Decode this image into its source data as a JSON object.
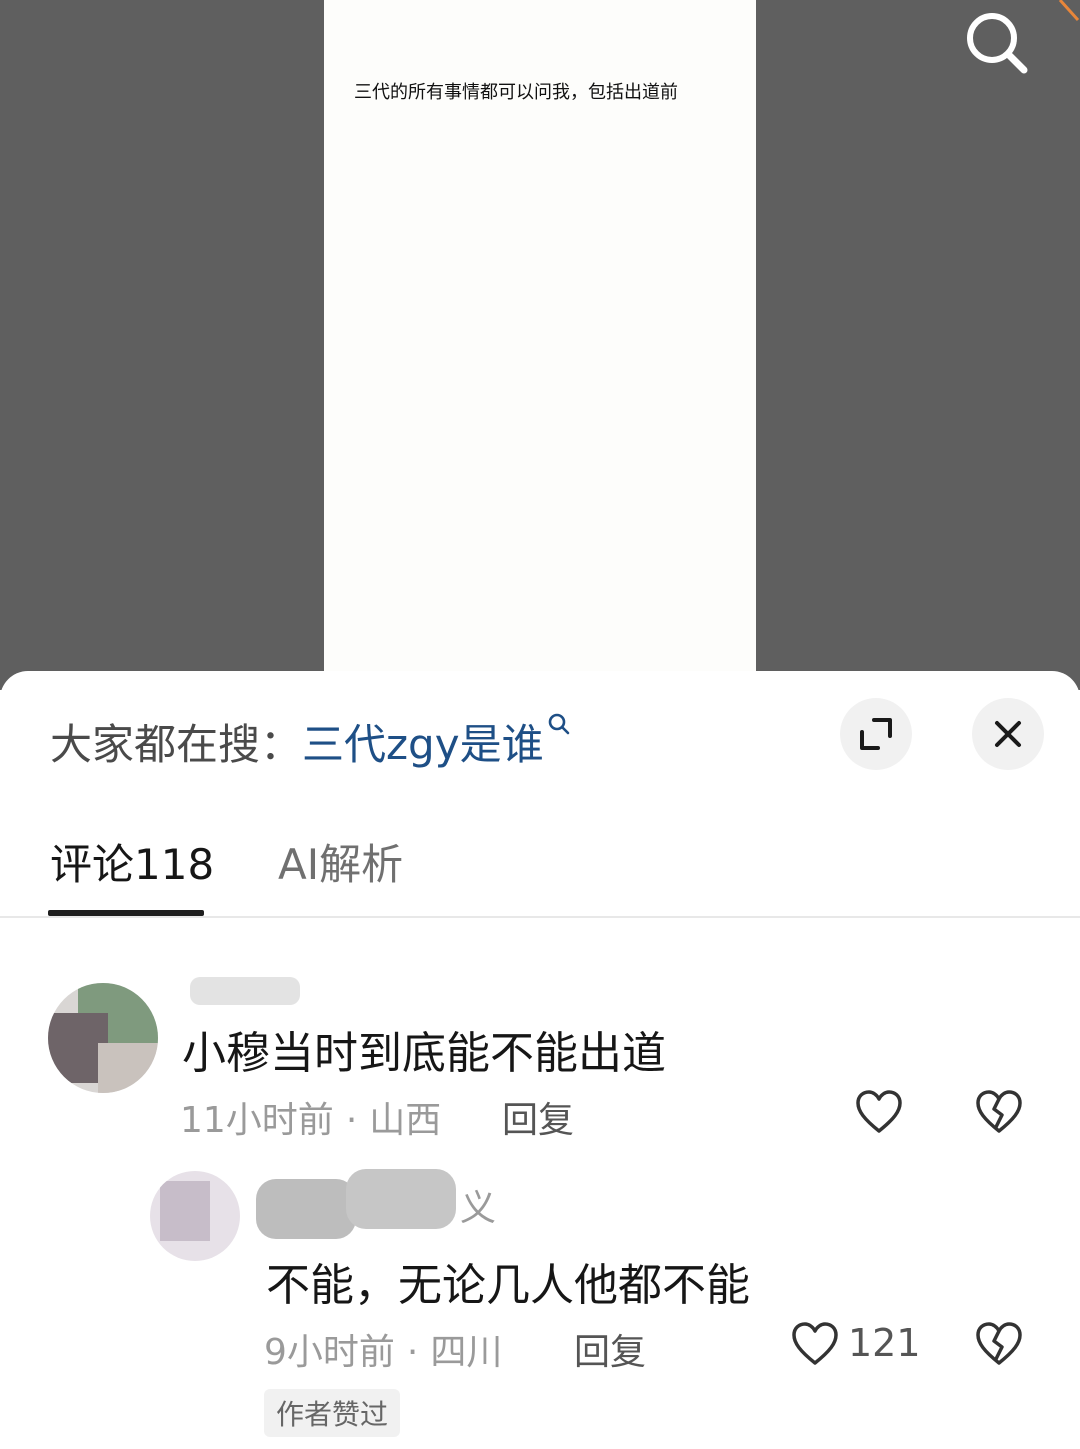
{
  "video": {
    "caption": "三代的所有事情都可以问我，包括出道前"
  },
  "header": {
    "trending_prefix": "大家都在搜：",
    "trending_query": "三代zgy是谁"
  },
  "tabs": [
    {
      "label": "评论118"
    },
    {
      "label": "AI解析"
    }
  ],
  "comments": [
    {
      "text": "小穆当时到底能不能出道",
      "time": "11小时前",
      "location": "山西",
      "reply_label": "回复",
      "like_count": ""
    },
    {
      "name_suffix": "义",
      "text": "不能，无论几人他都不能",
      "time": "9小时前",
      "location": "四川",
      "reply_label": "回复",
      "like_count": "121",
      "badge": "作者赞过"
    }
  ],
  "meta_separator": "·",
  "colors": {
    "video_bg": "#5f5f5f",
    "link_blue": "#1e4f86",
    "muted_text": "#9a9a9a"
  }
}
